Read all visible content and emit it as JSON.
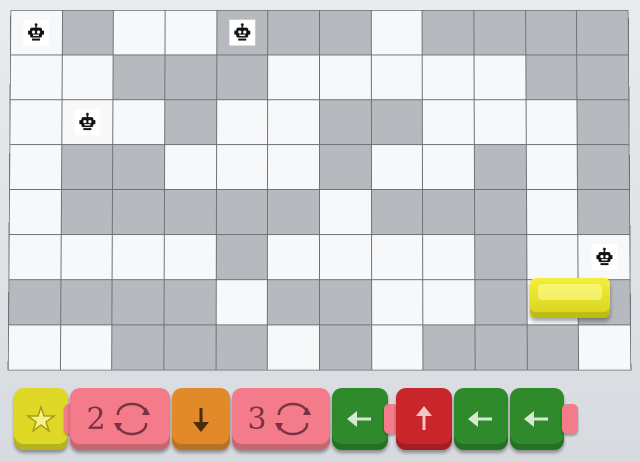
{
  "board": {
    "columns": 12,
    "rows": 8,
    "pattern": [
      "wgwwgggwgggg",
      "wwgggwwwwwgg",
      "wwwgwwggwwwg",
      "wggwwwgwwgwg",
      "wgggggwgggwg",
      "wwwwgwwwwgww",
      "ggggwggwwgwg",
      "wwgggwgwgggw"
    ],
    "robots": [
      {
        "row": 0,
        "col": 0,
        "icon": "robot-icon"
      },
      {
        "row": 0,
        "col": 4,
        "icon": "robot-icon"
      },
      {
        "row": 2,
        "col": 1,
        "icon": "robot-icon"
      },
      {
        "row": 5,
        "col": 11,
        "icon": "robot-icon"
      }
    ],
    "colors": {
      "white": "#f7f8f9",
      "gray": "#b6b9bd",
      "grid": "#6f7378"
    }
  },
  "toy_robot": {
    "color": "#e6e22a"
  },
  "program": {
    "blocks": [
      {
        "kind": "start",
        "icon": "star-icon",
        "color": "#dfd826"
      },
      {
        "kind": "loop",
        "count": "2",
        "icon": "loop-icon",
        "color": "#f47c8a"
      },
      {
        "kind": "move",
        "icon": "arrow-down-icon",
        "color": "#e28a2a"
      },
      {
        "kind": "loop",
        "count": "3",
        "icon": "loop-icon",
        "color": "#f47c8a"
      },
      {
        "kind": "move",
        "icon": "arrow-left-icon",
        "color": "#2e8a2a"
      },
      {
        "kind": "move",
        "icon": "arrow-up-icon",
        "color": "#c8262a"
      },
      {
        "kind": "move",
        "icon": "arrow-left-icon",
        "color": "#2e8a2a"
      },
      {
        "kind": "move",
        "icon": "arrow-left-icon",
        "color": "#2e8a2a"
      }
    ]
  }
}
